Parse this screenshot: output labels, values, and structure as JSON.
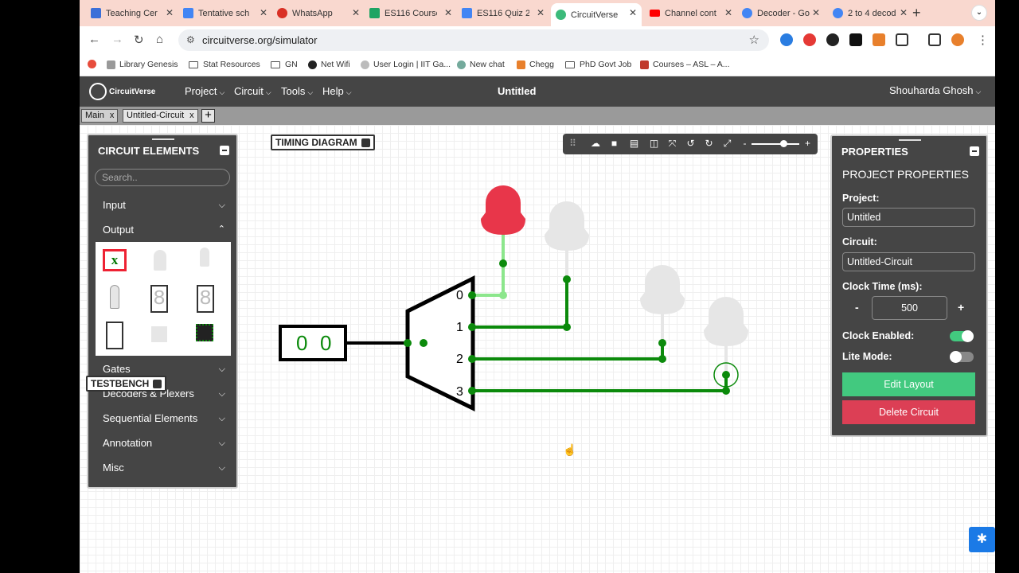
{
  "browser": {
    "tabs": [
      {
        "label": "Teaching Cer",
        "color": "#3b6fd8"
      },
      {
        "label": "Tentative sch",
        "color": "#4285f4"
      },
      {
        "label": "WhatsApp",
        "color": "#d93025"
      },
      {
        "label": "ES116 Course",
        "color": "#1fa463"
      },
      {
        "label": "ES116 Quiz 2",
        "color": "#4285f4"
      },
      {
        "label": "CircuitVerse",
        "color": "#3cba7a"
      },
      {
        "label": "Channel cont",
        "color": "#ff0000"
      },
      {
        "label": "Decoder - Go",
        "color": "#4285f4"
      },
      {
        "label": "2 to 4 decod",
        "color": "#4285f4"
      }
    ],
    "url": "circuitverse.org/simulator",
    "bookmarks": [
      "Library Genesis",
      "Stat Resources",
      "GN",
      "Net Wifi",
      "User Login | IIT Ga...",
      "New chat",
      "Chegg",
      "PhD Govt Job",
      "Courses – ASL – A..."
    ]
  },
  "cv": {
    "logo": "CircuitVerse",
    "menus": [
      "Project",
      "Circuit",
      "Tools",
      "Help"
    ],
    "title": "Untitled",
    "user": "Shouharda Ghosh",
    "circuit_tabs": [
      {
        "label": "Main",
        "close": "x"
      },
      {
        "label": "Untitled-Circuit",
        "close": "x"
      }
    ],
    "add_tab": "+"
  },
  "left_panel": {
    "title": "CIRCUIT ELEMENTS",
    "search_placeholder": "Search..",
    "categories": [
      "Input",
      "Output",
      "Gates",
      "Decoders & Plexers",
      "Sequential Elements",
      "Annotation",
      "Misc"
    ]
  },
  "timing_diagram": "TIMING DIAGRAM",
  "testbench": "TESTBENCH",
  "canvas": {
    "input_bits": "00",
    "mux_labels": [
      "0",
      "1",
      "2",
      "3"
    ],
    "active_output": 0,
    "led_colors": {
      "on": "#e8364a",
      "off": "#e6e6e6"
    },
    "wire_color": "#0b8a0b",
    "wire_active": "#8ce68c"
  },
  "right_panel": {
    "title": "PROPERTIES",
    "subtitle": "PROJECT PROPERTIES",
    "project_label": "Project:",
    "project_value": "Untitled",
    "circuit_label": "Circuit:",
    "circuit_value": "Untitled-Circuit",
    "clock_label": "Clock Time (ms):",
    "clock_value": "500",
    "clock_enabled_label": "Clock Enabled:",
    "clock_enabled": true,
    "lite_mode_label": "Lite Mode:",
    "lite_mode": false,
    "edit_layout": "Edit Layout",
    "delete_circuit": "Delete Circuit",
    "accent_green": "#42c97f",
    "accent_red": "#dc3f55"
  }
}
